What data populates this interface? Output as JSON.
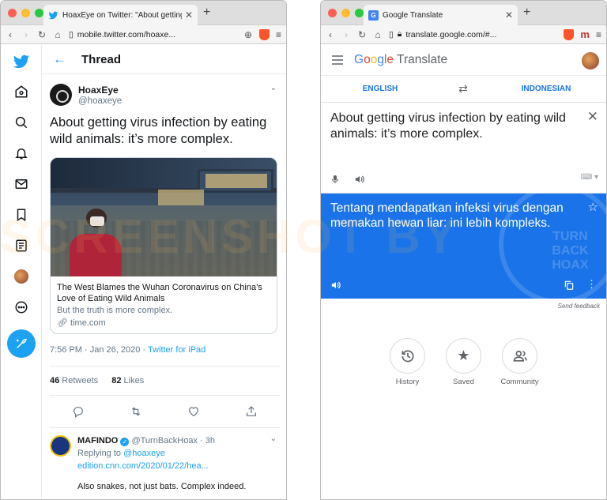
{
  "left_window": {
    "tab_title": "HoaxEye on Twitter: \"About getting",
    "url": "mobile.twitter.com/hoaxe...",
    "thread_title": "Thread",
    "tweet": {
      "name": "HoaxEye",
      "handle": "@hoaxeye",
      "text": "About getting virus infection by eating wild animals: it’s more complex.",
      "card_title": "The West Blames the Wuhan Coronavirus on China’s Love of Eating Wild Animals",
      "card_desc": "But the truth is more complex.",
      "card_link": "time.com",
      "time": "7:56 PM · Jan 26, 2020 · ",
      "source": "Twitter for iPad",
      "retweets": "46",
      "retweets_label": " Retweets",
      "likes": "82",
      "likes_label": " Likes"
    },
    "reply": {
      "name": "MAFINDO",
      "handle": "@TurnBackHoax · 3h",
      "replying_to_label": "Replying to ",
      "replying_to": "@hoaxeye",
      "link": "edition.cnn.com/2020/01/22/hea...",
      "text": "Also snakes, not just bats. Complex indeed."
    }
  },
  "right_window": {
    "tab_title": "Google Translate",
    "url": "translate.google.com/#...",
    "logo_word": "Translate",
    "source_lang": "ENGLISH",
    "target_lang": "INDONESIAN",
    "source_text": "About getting virus infection by eating wild animals: it’s more complex.",
    "translated_text": "Tentang mendapatkan infeksi virus dengan memakan hewan liar: ini lebih kompleks.",
    "send_feedback": "Send feedback",
    "buttons": [
      {
        "label": "History",
        "icon": "history-icon"
      },
      {
        "label": "Saved",
        "icon": "star-icon"
      },
      {
        "label": "Community",
        "icon": "community-icon"
      }
    ]
  },
  "watermark": "SCREENSHOT BY",
  "watermark_badge": "TURN BACK HOAX"
}
